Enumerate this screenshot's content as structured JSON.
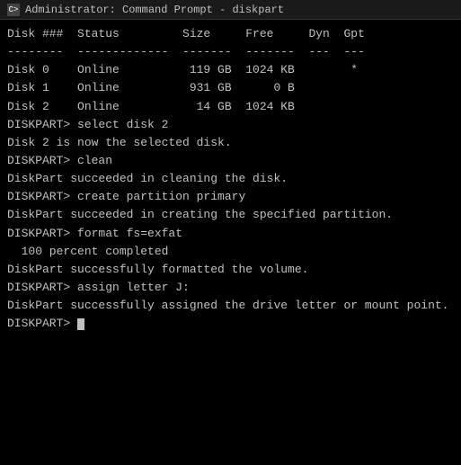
{
  "titleBar": {
    "icon": "C>",
    "title": "Administrator: Command Prompt - diskpart"
  },
  "terminal": {
    "lines": [
      {
        "id": "disk-header",
        "text": "Disk ###  Status         Size     Free     Dyn  Gpt"
      },
      {
        "id": "disk-sep",
        "text": "--------  -------------  -------  -------  ---  ---"
      },
      {
        "id": "disk0",
        "text": "Disk 0    Online          119 GB  1024 KB        *"
      },
      {
        "id": "disk1",
        "text": "Disk 1    Online          931 GB      0 B"
      },
      {
        "id": "disk2",
        "text": "Disk 2    Online           14 GB  1024 KB"
      },
      {
        "id": "blank1",
        "text": ""
      },
      {
        "id": "prompt1",
        "text": "DISKPART> select disk 2"
      },
      {
        "id": "blank2",
        "text": ""
      },
      {
        "id": "msg1",
        "text": "Disk 2 is now the selected disk."
      },
      {
        "id": "blank3",
        "text": ""
      },
      {
        "id": "prompt2",
        "text": "DISKPART> clean"
      },
      {
        "id": "blank4",
        "text": ""
      },
      {
        "id": "msg2",
        "text": "DiskPart succeeded in cleaning the disk."
      },
      {
        "id": "blank5",
        "text": ""
      },
      {
        "id": "prompt3",
        "text": "DISKPART> create partition primary"
      },
      {
        "id": "blank6",
        "text": ""
      },
      {
        "id": "msg3",
        "text": "DiskPart succeeded in creating the specified partition."
      },
      {
        "id": "blank7",
        "text": ""
      },
      {
        "id": "prompt4",
        "text": "DISKPART> format fs=exfat"
      },
      {
        "id": "blank8",
        "text": ""
      },
      {
        "id": "msg4",
        "text": "  100 percent completed"
      },
      {
        "id": "blank9",
        "text": ""
      },
      {
        "id": "msg5",
        "text": "DiskPart successfully formatted the volume."
      },
      {
        "id": "blank10",
        "text": ""
      },
      {
        "id": "prompt5",
        "text": "DISKPART> assign letter J:"
      },
      {
        "id": "blank11",
        "text": ""
      },
      {
        "id": "msg6",
        "text": "DiskPart successfully assigned the drive letter or mount point."
      },
      {
        "id": "blank12",
        "text": ""
      },
      {
        "id": "prompt6",
        "text": "DISKPART> "
      }
    ]
  }
}
